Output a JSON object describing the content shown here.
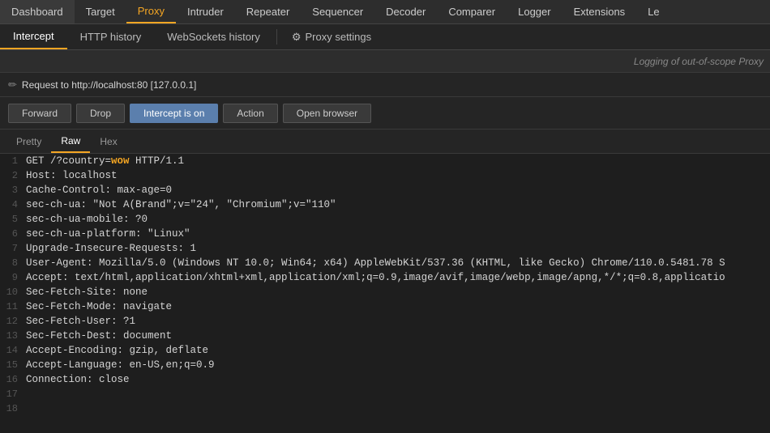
{
  "topNav": {
    "items": [
      {
        "label": "Dashboard",
        "active": false
      },
      {
        "label": "Target",
        "active": false
      },
      {
        "label": "Proxy",
        "active": true
      },
      {
        "label": "Intruder",
        "active": false
      },
      {
        "label": "Repeater",
        "active": false
      },
      {
        "label": "Sequencer",
        "active": false
      },
      {
        "label": "Decoder",
        "active": false
      },
      {
        "label": "Comparer",
        "active": false
      },
      {
        "label": "Logger",
        "active": false
      },
      {
        "label": "Extensions",
        "active": false
      },
      {
        "label": "Le",
        "active": false
      }
    ]
  },
  "secondNav": {
    "items": [
      {
        "label": "Intercept",
        "active": true
      },
      {
        "label": "HTTP history",
        "active": false
      },
      {
        "label": "WebSockets history",
        "active": false
      }
    ],
    "proxySettings": "Proxy settings"
  },
  "infoBar": {
    "text": "Logging of out-of-scope Proxy "
  },
  "requestBar": {
    "url": "Request to http://localhost:80 [127.0.0.1]"
  },
  "actionBar": {
    "forward": "Forward",
    "drop": "Drop",
    "intercept": "Intercept is on",
    "action": "Action",
    "openBrowser": "Open browser"
  },
  "contentTabs": {
    "items": [
      {
        "label": "Pretty",
        "active": false
      },
      {
        "label": "Raw",
        "active": true
      },
      {
        "label": "Hex",
        "active": false
      }
    ]
  },
  "codeLines": [
    {
      "num": 1,
      "content": "GET /?country=wow HTTP/1.1"
    },
    {
      "num": 2,
      "content": "Host: localhost"
    },
    {
      "num": 3,
      "content": "Cache-Control: max-age=0"
    },
    {
      "num": 4,
      "content": "sec-ch-ua: \"Not A(Brand\";v=\"24\", \"Chromium\";v=\"110\""
    },
    {
      "num": 5,
      "content": "sec-ch-ua-mobile: ?0"
    },
    {
      "num": 6,
      "content": "sec-ch-ua-platform: \"Linux\""
    },
    {
      "num": 7,
      "content": "Upgrade-Insecure-Requests: 1"
    },
    {
      "num": 8,
      "content": "User-Agent: Mozilla/5.0 (Windows NT 10.0; Win64; x64) AppleWebKit/537.36 (KHTML, like Gecko) Chrome/110.0.5481.78 S"
    },
    {
      "num": 9,
      "content": "Accept: text/html,application/xhtml+xml,application/xml;q=0.9,image/avif,image/webp,image/apng,*/*;q=0.8,applicatio"
    },
    {
      "num": 10,
      "content": "Sec-Fetch-Site: none"
    },
    {
      "num": 11,
      "content": "Sec-Fetch-Mode: navigate"
    },
    {
      "num": 12,
      "content": "Sec-Fetch-User: ?1"
    },
    {
      "num": 13,
      "content": "Sec-Fetch-Dest: document"
    },
    {
      "num": 14,
      "content": "Accept-Encoding: gzip, deflate"
    },
    {
      "num": 15,
      "content": "Accept-Language: en-US,en;q=0.9"
    },
    {
      "num": 16,
      "content": "Connection: close"
    },
    {
      "num": 17,
      "content": ""
    },
    {
      "num": 18,
      "content": "",
      "cursor": true
    }
  ]
}
